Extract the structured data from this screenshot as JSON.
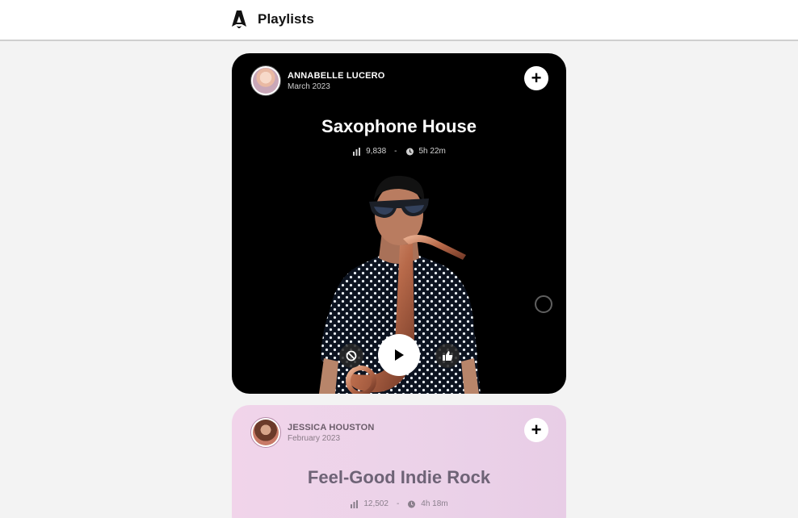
{
  "header": {
    "title": "Playlists",
    "logo_icon": "astro-logo-icon"
  },
  "playlists": [
    {
      "author": "ANNABELLE LUCERO",
      "date": "March 2023",
      "title": "Saxophone House",
      "plays": "9,838",
      "separator": "-",
      "duration": "5h 22m",
      "background": "#000000",
      "image": "saxophone-player-image",
      "controls": [
        "ban-icon",
        "play-icon",
        "thumbs-up-icon"
      ]
    },
    {
      "author": "JESSICA HOUSTON",
      "date": "February 2023",
      "title": "Feel-Good Indie Rock",
      "plays": "12,502",
      "separator": "-",
      "duration": "4h 18m",
      "background": "#eed3e9"
    }
  ],
  "add_button_label": "+"
}
